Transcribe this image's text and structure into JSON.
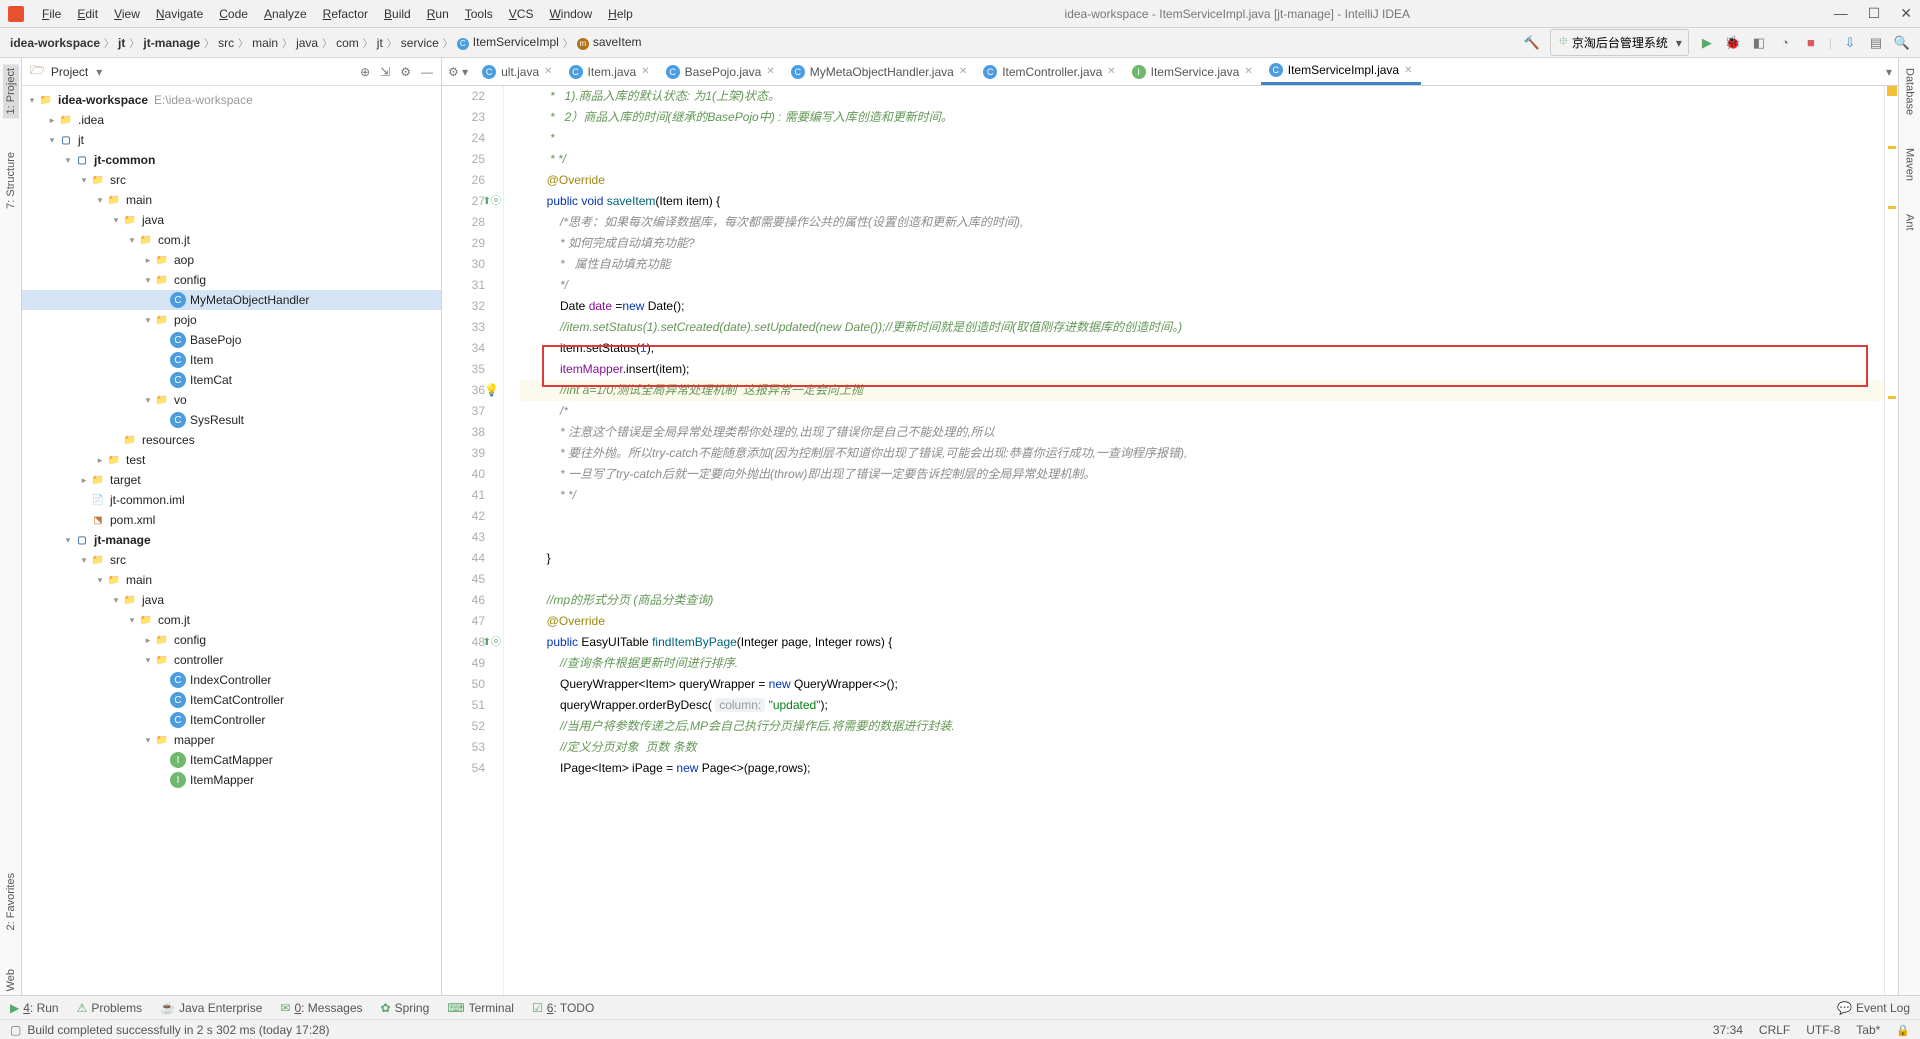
{
  "window": {
    "title": "idea-workspace - ItemServiceImpl.java [jt-manage] - IntelliJ IDEA"
  },
  "menu": {
    "items": [
      "File",
      "Edit",
      "View",
      "Navigate",
      "Code",
      "Analyze",
      "Refactor",
      "Build",
      "Run",
      "Tools",
      "VCS",
      "Window",
      "Help"
    ]
  },
  "breadcrumb": {
    "parts": [
      "idea-workspace",
      "jt",
      "jt-manage",
      "src",
      "main",
      "java",
      "com",
      "jt",
      "service",
      "ItemServiceImpl",
      "saveItem"
    ]
  },
  "runConfig": {
    "label": "京淘后台管理系统"
  },
  "leftGutter": {
    "tabs": [
      "1: Project",
      "7: Structure",
      "2: Favorites",
      "Web"
    ]
  },
  "rightGutter": {
    "tabs": [
      "Database",
      "Maven",
      "Ant"
    ]
  },
  "projectPanel": {
    "title": "Project",
    "root": {
      "label": "idea-workspace",
      "hint": "E:\\idea-workspace"
    },
    "tree": [
      {
        "indent": 1,
        "arrow": "closed",
        "icon": "folder",
        "label": ".idea"
      },
      {
        "indent": 1,
        "arrow": "open",
        "icon": "module",
        "label": "jt"
      },
      {
        "indent": 2,
        "arrow": "open",
        "icon": "module",
        "label": "jt-common",
        "bold": true
      },
      {
        "indent": 3,
        "arrow": "open",
        "icon": "folder",
        "label": "src"
      },
      {
        "indent": 4,
        "arrow": "open",
        "icon": "folder",
        "label": "main"
      },
      {
        "indent": 5,
        "arrow": "open",
        "icon": "folder",
        "label": "java"
      },
      {
        "indent": 6,
        "arrow": "open",
        "icon": "folder",
        "label": "com.jt"
      },
      {
        "indent": 7,
        "arrow": "closed",
        "icon": "folder",
        "label": "aop"
      },
      {
        "indent": 7,
        "arrow": "open",
        "icon": "folder",
        "label": "config"
      },
      {
        "indent": 8,
        "arrow": "",
        "icon": "class-c",
        "label": "MyMetaObjectHandler",
        "selected": true
      },
      {
        "indent": 7,
        "arrow": "open",
        "icon": "folder",
        "label": "pojo"
      },
      {
        "indent": 8,
        "arrow": "",
        "icon": "class-c",
        "label": "BasePojo"
      },
      {
        "indent": 8,
        "arrow": "",
        "icon": "class-c",
        "label": "Item"
      },
      {
        "indent": 8,
        "arrow": "",
        "icon": "class-c",
        "label": "ItemCat"
      },
      {
        "indent": 7,
        "arrow": "open",
        "icon": "folder",
        "label": "vo"
      },
      {
        "indent": 8,
        "arrow": "",
        "icon": "class-c",
        "label": "SysResult"
      },
      {
        "indent": 5,
        "arrow": "",
        "icon": "folder",
        "label": "resources"
      },
      {
        "indent": 4,
        "arrow": "closed",
        "icon": "folder",
        "label": "test"
      },
      {
        "indent": 3,
        "arrow": "closed",
        "icon": "folder-orange",
        "label": "target"
      },
      {
        "indent": 3,
        "arrow": "",
        "icon": "file",
        "label": "jt-common.iml"
      },
      {
        "indent": 3,
        "arrow": "",
        "icon": "xml",
        "label": "pom.xml"
      },
      {
        "indent": 2,
        "arrow": "open",
        "icon": "module",
        "label": "jt-manage",
        "bold": true
      },
      {
        "indent": 3,
        "arrow": "open",
        "icon": "folder",
        "label": "src"
      },
      {
        "indent": 4,
        "arrow": "open",
        "icon": "folder",
        "label": "main"
      },
      {
        "indent": 5,
        "arrow": "open",
        "icon": "folder",
        "label": "java"
      },
      {
        "indent": 6,
        "arrow": "open",
        "icon": "folder",
        "label": "com.jt"
      },
      {
        "indent": 7,
        "arrow": "closed",
        "icon": "folder",
        "label": "config"
      },
      {
        "indent": 7,
        "arrow": "open",
        "icon": "folder",
        "label": "controller"
      },
      {
        "indent": 8,
        "arrow": "",
        "icon": "class-c",
        "label": "IndexController"
      },
      {
        "indent": 8,
        "arrow": "",
        "icon": "class-c",
        "label": "ItemCatController"
      },
      {
        "indent": 8,
        "arrow": "",
        "icon": "class-c",
        "label": "ItemController"
      },
      {
        "indent": 7,
        "arrow": "open",
        "icon": "folder",
        "label": "mapper"
      },
      {
        "indent": 8,
        "arrow": "",
        "icon": "interface-i",
        "label": "ItemCatMapper"
      },
      {
        "indent": 8,
        "arrow": "",
        "icon": "interface-i",
        "label": "ItemMapper"
      }
    ]
  },
  "editorTabs": {
    "tabs": [
      {
        "label": "ult.java",
        "icon": "c"
      },
      {
        "label": "Item.java",
        "icon": "c"
      },
      {
        "label": "BasePojo.java",
        "icon": "c"
      },
      {
        "label": "MyMetaObjectHandler.java",
        "icon": "c"
      },
      {
        "label": "ItemController.java",
        "icon": "c"
      },
      {
        "label": "ItemService.java",
        "icon": "i"
      },
      {
        "label": "ItemServiceImpl.java",
        "icon": "c",
        "active": true
      }
    ]
  },
  "code": {
    "startLine": 22,
    "lines": [
      {
        "n": 22,
        "type": "cmt-doc",
        "text": " *   1).商品入库的默认状态: 为1(上架)状态。"
      },
      {
        "n": 23,
        "type": "cmt-doc",
        "text": " *   2）商品入库的时间(继承的BasePojo中) : 需要编写入库创造和更新时间。"
      },
      {
        "n": 24,
        "type": "cmt-doc",
        "text": " *"
      },
      {
        "n": 25,
        "type": "cmt-doc",
        "text": " * */"
      },
      {
        "n": 26,
        "type": "ann",
        "text": "@Override"
      },
      {
        "n": 27,
        "type": "sig",
        "kw1": "public",
        "kw2": "void",
        "fn": "saveItem",
        "rest": "(Item item) {",
        "mark": true
      },
      {
        "n": 28,
        "type": "cmt",
        "text": "    /*思考：如果每次编译数据库，每次都需要操作公共的属性(设置创造和更新入库的时间),"
      },
      {
        "n": 29,
        "type": "cmt",
        "text": "    * 如何完成自动填充功能?"
      },
      {
        "n": 30,
        "type": "cmt",
        "text": "    *   属性自动填充功能"
      },
      {
        "n": 31,
        "type": "cmt",
        "text": "    */"
      },
      {
        "n": 32,
        "type": "code",
        "html": "    Date <span class='fld'>date</span> =<span class='kw'>new</span> Date();"
      },
      {
        "n": 33,
        "type": "cmt-doc",
        "text": "    //item.setStatus(1).setCreated(date).setUpdated(new Date());//更新时间就是创造时间(取值刚存进数据库的创造时间。)"
      },
      {
        "n": 34,
        "type": "code",
        "html": "    item.setStatus(<span class='num'>1</span>);"
      },
      {
        "n": 35,
        "type": "code",
        "html": "    <span class='fld'>itemMapper</span>.insert(item);"
      },
      {
        "n": 36,
        "type": "cmt-doc",
        "text": "    //int a=1/0;测试全局异常处理机制  这报异常一定会向上抛",
        "caret": true,
        "bulb": true
      },
      {
        "n": 37,
        "type": "cmt",
        "text": "    /*"
      },
      {
        "n": 38,
        "type": "cmt",
        "text": "    * 注意这个错误是全局异常处理类帮你处理的,出现了错误你是自己不能处理的,所以"
      },
      {
        "n": 39,
        "type": "cmt",
        "text": "    * 要往外抛。所以try-catch不能随意添加(因为控制层不知道你出现了错误,可能会出现:恭喜你运行成功,一查询程序报错),"
      },
      {
        "n": 40,
        "type": "cmt",
        "text": "    * 一旦写了try-catch后就一定要向外抛出(throw)即出现了错误一定要告诉控制层的全局异常处理机制。"
      },
      {
        "n": 41,
        "type": "cmt",
        "text": "    * */"
      },
      {
        "n": 42,
        "type": "plain",
        "text": ""
      },
      {
        "n": 43,
        "type": "plain",
        "text": ""
      },
      {
        "n": 44,
        "type": "plain",
        "text": "}"
      },
      {
        "n": 45,
        "type": "plain",
        "text": ""
      },
      {
        "n": 46,
        "type": "cmt-doc",
        "text": "//mp的形式分页 (商品分类查询)"
      },
      {
        "n": 47,
        "type": "ann",
        "text": "@Override"
      },
      {
        "n": 48,
        "type": "sig2",
        "kw1": "public",
        "ret": "EasyUITable",
        "fn": "findItemByPage",
        "rest": "(Integer page, Integer rows) {",
        "mark": true
      },
      {
        "n": 49,
        "type": "cmt-doc",
        "text": "    //查询条件根据更新时间进行排序."
      },
      {
        "n": 50,
        "type": "code",
        "html": "    QueryWrapper&lt;Item&gt; queryWrapper = <span class='kw'>new</span> QueryWrapper&lt;&gt;();"
      },
      {
        "n": 51,
        "type": "code",
        "html": "    queryWrapper.orderByDesc( <span class='param-hint'>column:</span> <span class='str'>\"updated\"</span>);"
      },
      {
        "n": 52,
        "type": "cmt-doc",
        "text": "    //当用户将参数传递之后,MP会自己执行分页操作后,将需要的数据进行封装."
      },
      {
        "n": 53,
        "type": "cmt-doc",
        "text": "    //定义分页对象  页数 条数"
      },
      {
        "n": 54,
        "type": "code",
        "html": "    IPage&lt;Item&gt; iPage = <span class='kw'>new</span> Page&lt;&gt;(page,rows);"
      }
    ],
    "redBox": {
      "startLine": 33,
      "endLine": 34
    }
  },
  "bottomTabs": {
    "items": [
      "4: Run",
      "Problems",
      "Java Enterprise",
      "0: Messages",
      "Spring",
      "Terminal",
      "6: TODO"
    ],
    "eventLog": "Event Log"
  },
  "statusbar": {
    "msg": "Build completed successfully in 2 s 302 ms (today 17:28)",
    "pos": "37:34",
    "sep": "CRLF",
    "enc": "UTF-8",
    "tab": "Tab*"
  }
}
